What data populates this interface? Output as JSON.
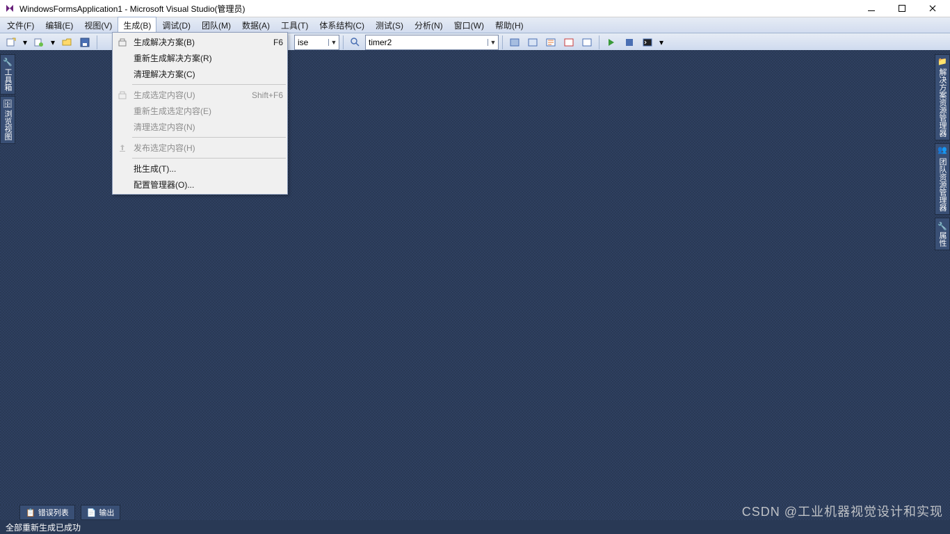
{
  "title": "WindowsFormsApplication1 - Microsoft Visual Studio(管理员)",
  "menus": {
    "file": "文件(F)",
    "edit": "编辑(E)",
    "view": "视图(V)",
    "build": "生成(B)",
    "debug": "调试(D)",
    "team": "团队(M)",
    "data": "数据(A)",
    "tools": "工具(T)",
    "arch": "体系结构(C)",
    "test": "测试(S)",
    "analyze": "分析(N)",
    "window": "窗口(W)",
    "help": "帮助(H)"
  },
  "build_menu": {
    "build_solution": {
      "label": "生成解决方案(B)",
      "shortcut": "F6"
    },
    "rebuild_solution": {
      "label": "重新生成解决方案(R)"
    },
    "clean_solution": {
      "label": "清理解决方案(C)"
    },
    "build_selection": {
      "label": "生成选定内容(U)",
      "shortcut": "Shift+F6"
    },
    "rebuild_selection": {
      "label": "重新生成选定内容(E)"
    },
    "clean_selection": {
      "label": "清理选定内容(N)"
    },
    "publish_selection": {
      "label": "发布选定内容(H)"
    },
    "batch_build": {
      "label": "批生成(T)..."
    },
    "config_manager": {
      "label": "配置管理器(O)..."
    }
  },
  "toolbar": {
    "config_visible": "ise",
    "find_target": "timer2"
  },
  "left_tabs": {
    "toolbox": "工具箱",
    "server_explorer": "浏览视图"
  },
  "right_tabs": {
    "solution_explorer": "解决方案资源管理器",
    "team_explorer": "团队资源管理器",
    "properties": "属性"
  },
  "bottom_tabs": {
    "error_list": "错误列表",
    "output": "输出"
  },
  "status": "全部重新生成已成功",
  "watermark": "CSDN @工业机器视觉设计和实现"
}
